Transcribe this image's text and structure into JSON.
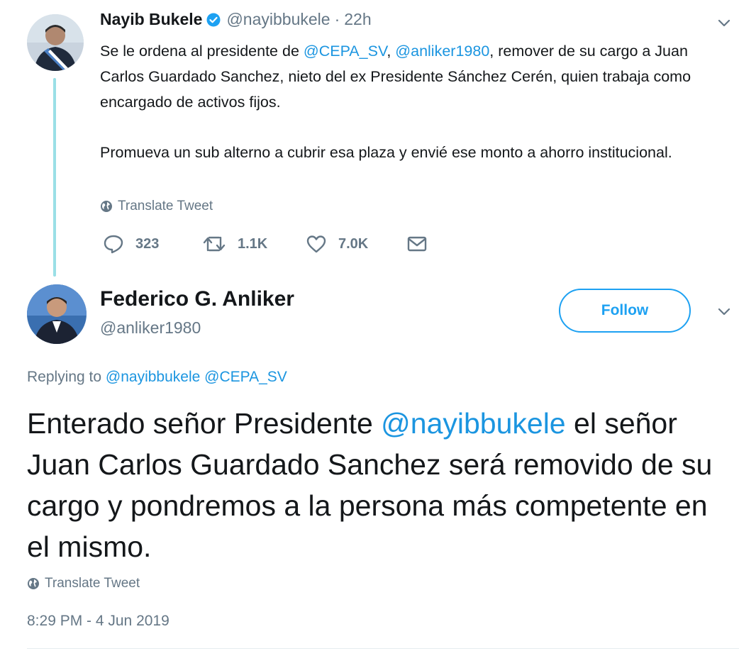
{
  "colors": {
    "link": "#1b95e0",
    "muted": "#657786",
    "follow": "#1da1f2",
    "thread_line": "#9adfe6",
    "text": "#14171a"
  },
  "tweet1": {
    "name": "Nayib Bukele",
    "handle": "@nayibbukele",
    "separator": "·",
    "time": "22h",
    "verified_icon": "verified-badge-icon",
    "line1_pre": "Se le ordena al presidente de ",
    "mention_cepa": "@CEPA_SV",
    "comma": ", ",
    "mention_anliker": "@anliker1980",
    "line1_post": ", remover de su cargo a Juan Carlos Guardado Sanchez, nieto del ex Presidente Sánchez Cerén, quien trabaja como encargado de activos fijos.",
    "paragraph2": "Promueva un sub alterno a cubrir esa plaza y envié ese monto a ahorro institucional.",
    "translate": "Translate Tweet",
    "actions": {
      "replies": "323",
      "retweets": "1.1K",
      "likes": "7.0K"
    }
  },
  "tweet2": {
    "name": "Federico G. Anliker",
    "handle": "@anliker1980",
    "follow_label": "Follow",
    "replying_label": "Replying to ",
    "replying_mentions": "@nayibbukele @CEPA_SV",
    "text_pre": "Enterado señor Presidente ",
    "text_mention": "@nayibbukele",
    "text_post": " el señor Juan Carlos Guardado Sanchez será removido de su cargo y pondremos a la persona más competente en el mismo.",
    "translate": "Translate Tweet",
    "timestamp": "8:29 PM - 4 Jun 2019"
  }
}
